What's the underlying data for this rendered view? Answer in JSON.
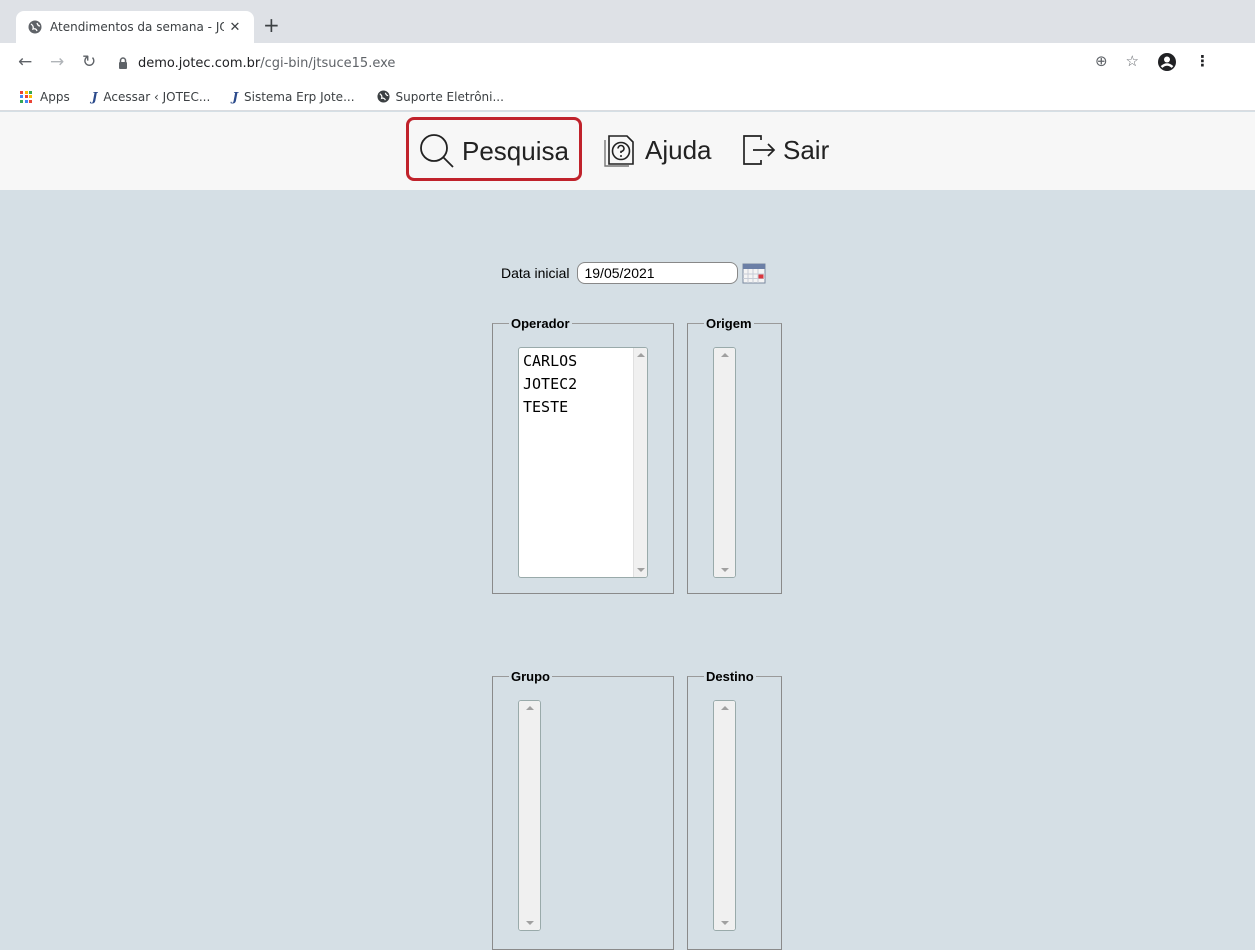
{
  "browser": {
    "tab_title": "Atendimentos da semana - JO",
    "tab_close": "✕",
    "new_tab": "+",
    "url_host": "demo.jotec.com.br",
    "url_path": "/cgi-bin/jtsuce15.exe",
    "bookmarks": [
      {
        "label": "Apps"
      },
      {
        "label": "Acessar ‹ JOTEC..."
      },
      {
        "label": "Sistema Erp Jote..."
      },
      {
        "label": "Suporte Eletrôni..."
      }
    ]
  },
  "menu": {
    "pesquisa": "Pesquisa",
    "ajuda": "Ajuda",
    "sair": "Sair",
    "highlight_color": "#c0222b"
  },
  "form": {
    "date_label": "Data inicial",
    "date_value": "19/05/2021",
    "operador": {
      "legend": "Operador",
      "items": [
        "CARLOS",
        "JOTEC2",
        "TESTE"
      ]
    },
    "origem": {
      "legend": "Origem",
      "items": []
    },
    "grupo": {
      "legend": "Grupo",
      "items": []
    },
    "destino": {
      "legend": "Destino",
      "items": []
    }
  },
  "colors": {
    "page_background": "#d5dfe5",
    "header_background": "#f7f7f7"
  }
}
